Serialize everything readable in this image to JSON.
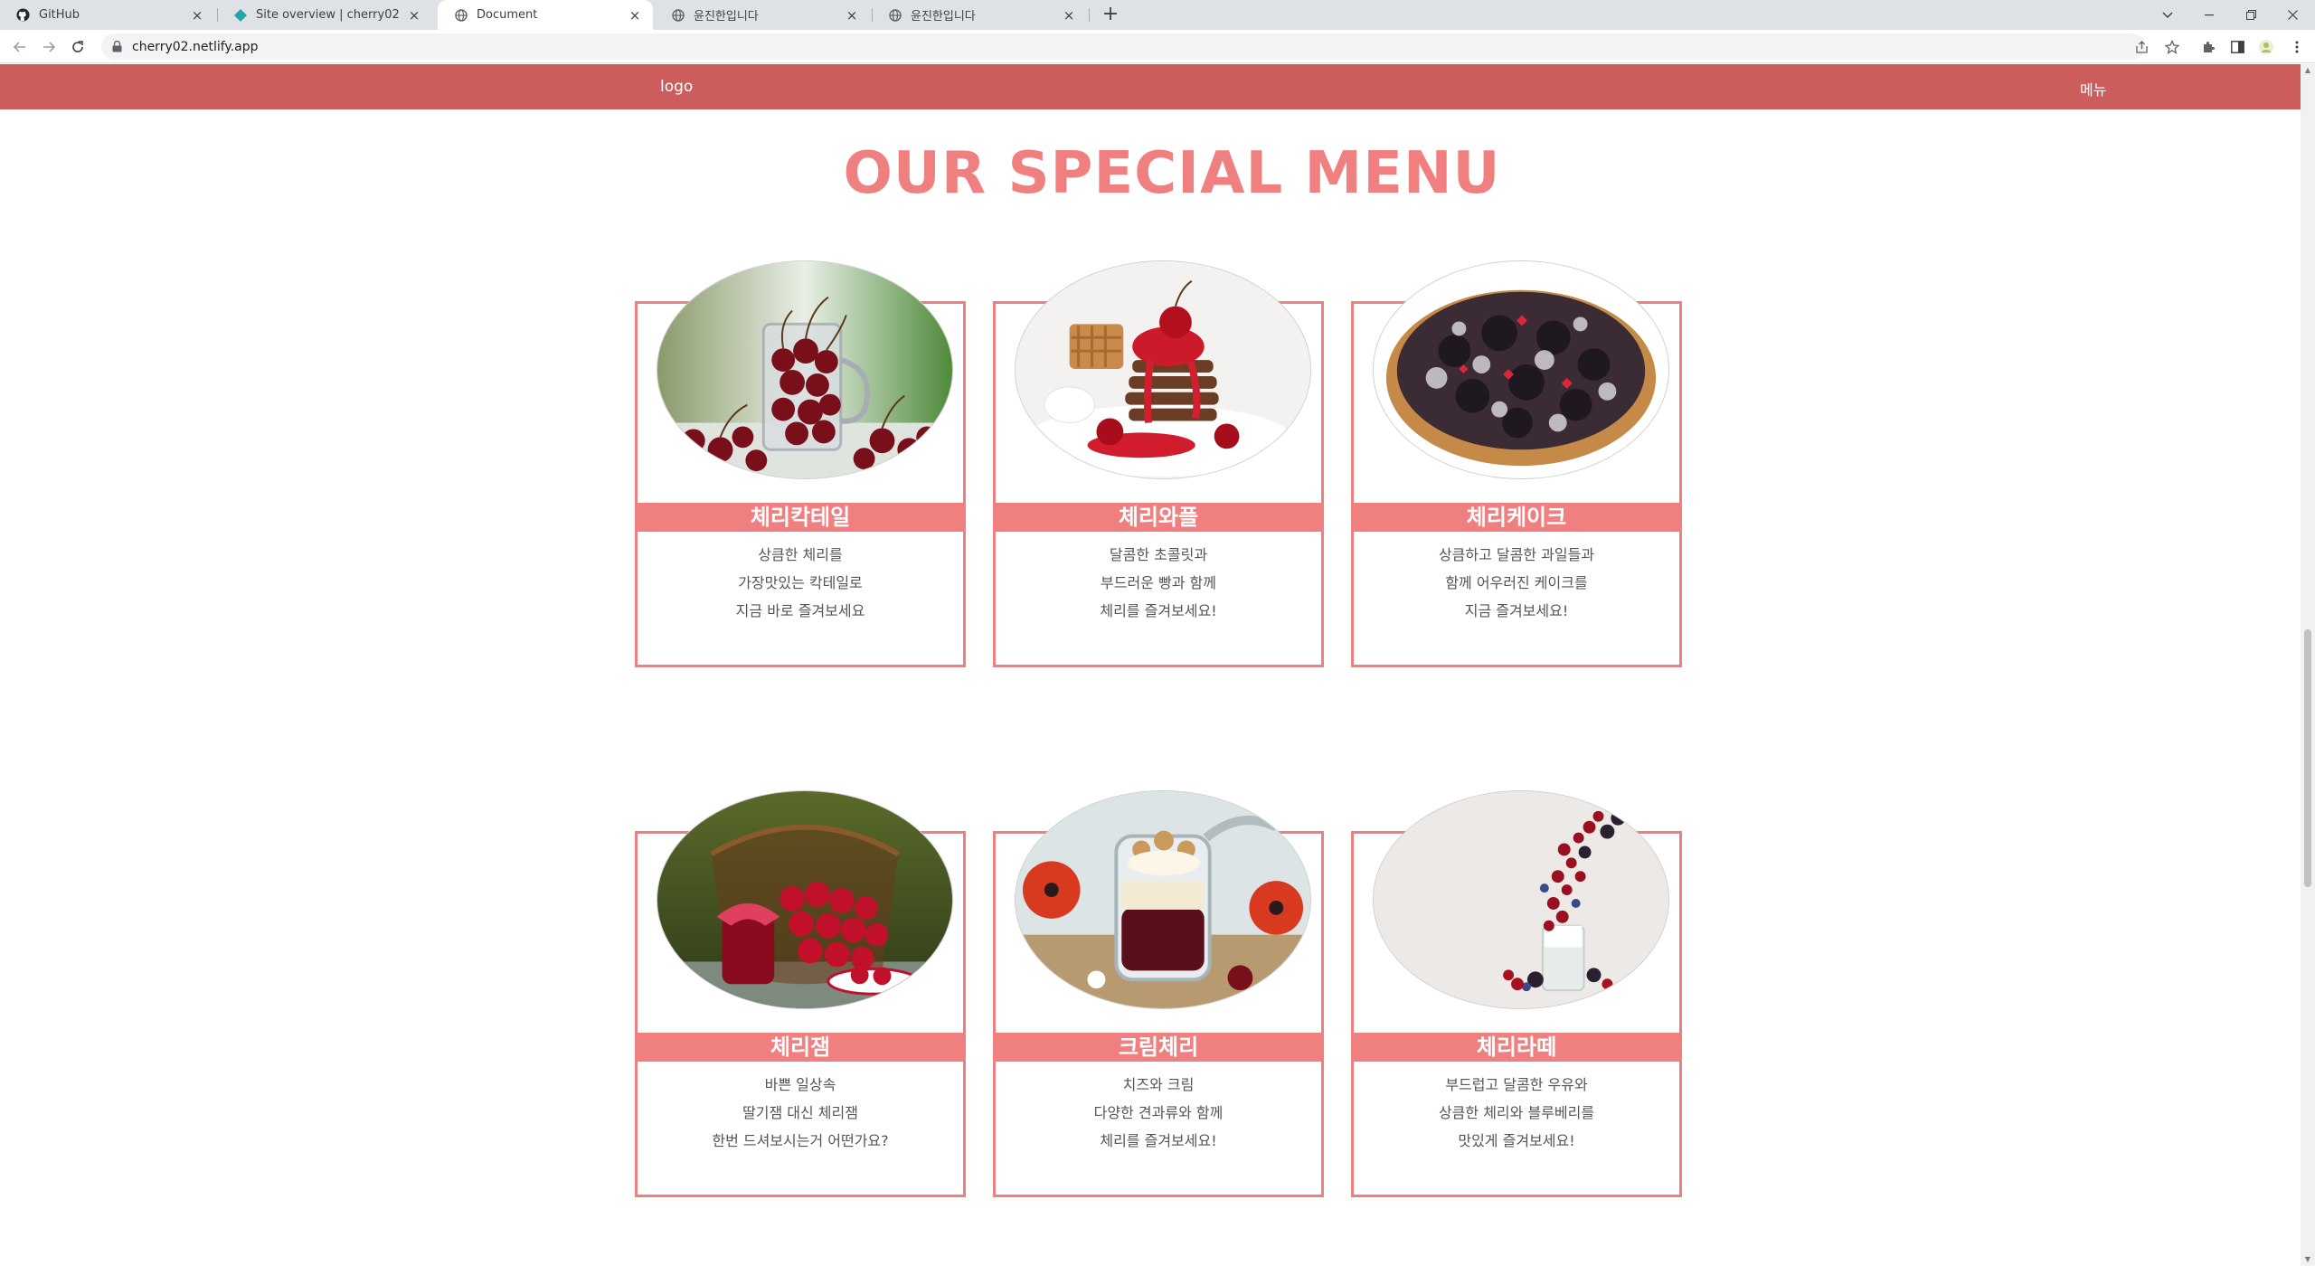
{
  "browser": {
    "tabs": [
      {
        "title": "GitHub",
        "icon": "github-icon",
        "active": false
      },
      {
        "title": "Site overview | cherry02",
        "icon": "netlify-icon",
        "active": false
      },
      {
        "title": "Document",
        "icon": "globe-icon",
        "active": true
      },
      {
        "title": "윤진한입니다",
        "icon": "globe-icon",
        "active": false
      },
      {
        "title": "윤진한입니다",
        "icon": "globe-icon",
        "active": false
      }
    ],
    "url": "cherry02.netlify.app"
  },
  "site": {
    "logo": "logo",
    "menu": "메뉴",
    "section_title": "OUR SPECIAL MENU",
    "accent_color": "#f08080",
    "header_color": "#cd5c5c",
    "items": [
      {
        "name": "체리칵테일",
        "lines": [
          "상큼한 체리를",
          "가장맛있는 칵테일로",
          "지금 바로 즐겨보세요"
        ],
        "image": "cherry-glass-image"
      },
      {
        "name": "체리와플",
        "lines": [
          "달콤한 초콜릿과",
          "부드러운 빵과 함께",
          "체리를 즐겨보세요!"
        ],
        "image": "cherry-waffle-image"
      },
      {
        "name": "체리케이크",
        "lines": [
          "상큼하고 달콤한 과일들과",
          "함께 어우러진 케이크를",
          "지금 즐겨보세요!"
        ],
        "image": "cherry-tart-image"
      },
      {
        "name": "체리잼",
        "lines": [
          "바쁜 일상속",
          "딸기잼 대신 체리잼",
          "한번 드셔보시는거 어떤가요?"
        ],
        "image": "cherry-basket-image"
      },
      {
        "name": "크림체리",
        "lines": [
          "치즈와 크림",
          "다양한 견과류와 함께",
          "체리를 즐겨보세요!"
        ],
        "image": "cherry-cream-jar-image"
      },
      {
        "name": "체리라떼",
        "lines": [
          "부드럽고 달콤한 우유와",
          "상큼한 체리와 블루베리를",
          "맛있게 즐겨보세요!"
        ],
        "image": "berry-milk-image"
      }
    ]
  }
}
